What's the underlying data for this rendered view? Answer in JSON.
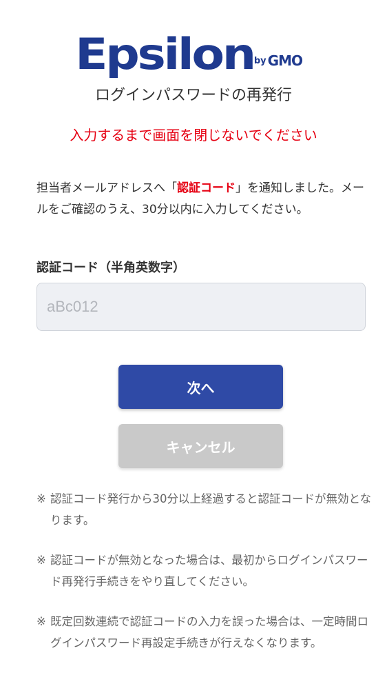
{
  "logo": {
    "word": "Epsilon",
    "by": "by",
    "gmo": "GMO",
    "color": "#1f3a8f"
  },
  "title": "ログインパスワードの再発行",
  "warning": "入力するまで画面を閉じないでください",
  "notice": {
    "before": "担当者メールアドレスへ「",
    "code": "認証コード",
    "after": "」を通知しました。メールをご確認のうえ、30分以内に入力してください。"
  },
  "code_field": {
    "label": "認証コード（半角英数字）",
    "placeholder": "aBc012",
    "value": ""
  },
  "buttons": {
    "next": "次へ",
    "cancel": "キャンセル"
  },
  "notes": [
    "認証コード発行から30分以上経過すると認証コードが無効となります。",
    "認証コードが無効となった場合は、最初からログインパスワード再発行手続きをやり直してください。",
    "既定回数連続で認証コードの入力を誤った場合は、一定時間ログインパスワード再設定手続きが行えなくなります。"
  ],
  "note_mark": "※",
  "colors": {
    "primary": "#2f4aa6",
    "alert": "#e60012",
    "disabled": "#c9c9c9"
  }
}
